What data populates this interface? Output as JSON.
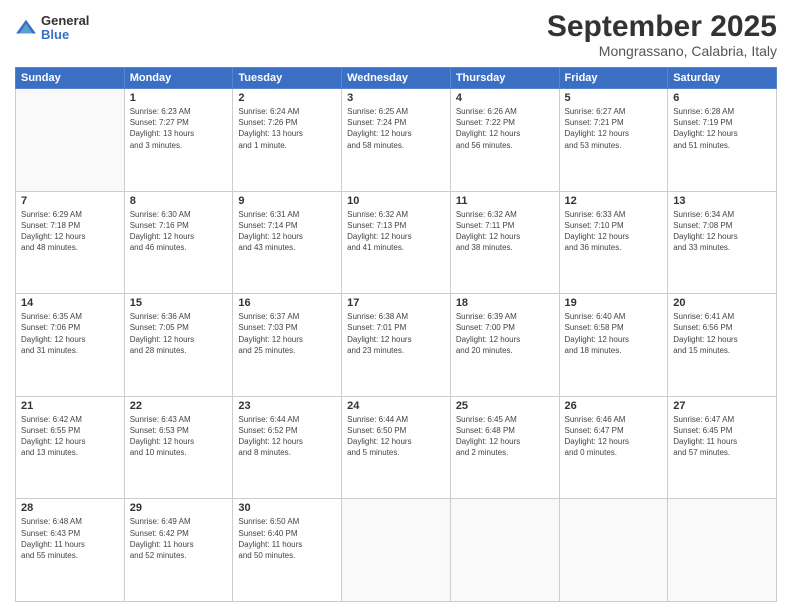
{
  "logo": {
    "general": "General",
    "blue": "Blue"
  },
  "title": "September 2025",
  "location": "Mongrassano, Calabria, Italy",
  "weekdays": [
    "Sunday",
    "Monday",
    "Tuesday",
    "Wednesday",
    "Thursday",
    "Friday",
    "Saturday"
  ],
  "weeks": [
    [
      {
        "day": "",
        "info": ""
      },
      {
        "day": "1",
        "info": "Sunrise: 6:23 AM\nSunset: 7:27 PM\nDaylight: 13 hours\nand 3 minutes."
      },
      {
        "day": "2",
        "info": "Sunrise: 6:24 AM\nSunset: 7:26 PM\nDaylight: 13 hours\nand 1 minute."
      },
      {
        "day": "3",
        "info": "Sunrise: 6:25 AM\nSunset: 7:24 PM\nDaylight: 12 hours\nand 58 minutes."
      },
      {
        "day": "4",
        "info": "Sunrise: 6:26 AM\nSunset: 7:22 PM\nDaylight: 12 hours\nand 56 minutes."
      },
      {
        "day": "5",
        "info": "Sunrise: 6:27 AM\nSunset: 7:21 PM\nDaylight: 12 hours\nand 53 minutes."
      },
      {
        "day": "6",
        "info": "Sunrise: 6:28 AM\nSunset: 7:19 PM\nDaylight: 12 hours\nand 51 minutes."
      }
    ],
    [
      {
        "day": "7",
        "info": "Sunrise: 6:29 AM\nSunset: 7:18 PM\nDaylight: 12 hours\nand 48 minutes."
      },
      {
        "day": "8",
        "info": "Sunrise: 6:30 AM\nSunset: 7:16 PM\nDaylight: 12 hours\nand 46 minutes."
      },
      {
        "day": "9",
        "info": "Sunrise: 6:31 AM\nSunset: 7:14 PM\nDaylight: 12 hours\nand 43 minutes."
      },
      {
        "day": "10",
        "info": "Sunrise: 6:32 AM\nSunset: 7:13 PM\nDaylight: 12 hours\nand 41 minutes."
      },
      {
        "day": "11",
        "info": "Sunrise: 6:32 AM\nSunset: 7:11 PM\nDaylight: 12 hours\nand 38 minutes."
      },
      {
        "day": "12",
        "info": "Sunrise: 6:33 AM\nSunset: 7:10 PM\nDaylight: 12 hours\nand 36 minutes."
      },
      {
        "day": "13",
        "info": "Sunrise: 6:34 AM\nSunset: 7:08 PM\nDaylight: 12 hours\nand 33 minutes."
      }
    ],
    [
      {
        "day": "14",
        "info": "Sunrise: 6:35 AM\nSunset: 7:06 PM\nDaylight: 12 hours\nand 31 minutes."
      },
      {
        "day": "15",
        "info": "Sunrise: 6:36 AM\nSunset: 7:05 PM\nDaylight: 12 hours\nand 28 minutes."
      },
      {
        "day": "16",
        "info": "Sunrise: 6:37 AM\nSunset: 7:03 PM\nDaylight: 12 hours\nand 25 minutes."
      },
      {
        "day": "17",
        "info": "Sunrise: 6:38 AM\nSunset: 7:01 PM\nDaylight: 12 hours\nand 23 minutes."
      },
      {
        "day": "18",
        "info": "Sunrise: 6:39 AM\nSunset: 7:00 PM\nDaylight: 12 hours\nand 20 minutes."
      },
      {
        "day": "19",
        "info": "Sunrise: 6:40 AM\nSunset: 6:58 PM\nDaylight: 12 hours\nand 18 minutes."
      },
      {
        "day": "20",
        "info": "Sunrise: 6:41 AM\nSunset: 6:56 PM\nDaylight: 12 hours\nand 15 minutes."
      }
    ],
    [
      {
        "day": "21",
        "info": "Sunrise: 6:42 AM\nSunset: 6:55 PM\nDaylight: 12 hours\nand 13 minutes."
      },
      {
        "day": "22",
        "info": "Sunrise: 6:43 AM\nSunset: 6:53 PM\nDaylight: 12 hours\nand 10 minutes."
      },
      {
        "day": "23",
        "info": "Sunrise: 6:44 AM\nSunset: 6:52 PM\nDaylight: 12 hours\nand 8 minutes."
      },
      {
        "day": "24",
        "info": "Sunrise: 6:44 AM\nSunset: 6:50 PM\nDaylight: 12 hours\nand 5 minutes."
      },
      {
        "day": "25",
        "info": "Sunrise: 6:45 AM\nSunset: 6:48 PM\nDaylight: 12 hours\nand 2 minutes."
      },
      {
        "day": "26",
        "info": "Sunrise: 6:46 AM\nSunset: 6:47 PM\nDaylight: 12 hours\nand 0 minutes."
      },
      {
        "day": "27",
        "info": "Sunrise: 6:47 AM\nSunset: 6:45 PM\nDaylight: 11 hours\nand 57 minutes."
      }
    ],
    [
      {
        "day": "28",
        "info": "Sunrise: 6:48 AM\nSunset: 6:43 PM\nDaylight: 11 hours\nand 55 minutes."
      },
      {
        "day": "29",
        "info": "Sunrise: 6:49 AM\nSunset: 6:42 PM\nDaylight: 11 hours\nand 52 minutes."
      },
      {
        "day": "30",
        "info": "Sunrise: 6:50 AM\nSunset: 6:40 PM\nDaylight: 11 hours\nand 50 minutes."
      },
      {
        "day": "",
        "info": ""
      },
      {
        "day": "",
        "info": ""
      },
      {
        "day": "",
        "info": ""
      },
      {
        "day": "",
        "info": ""
      }
    ]
  ]
}
